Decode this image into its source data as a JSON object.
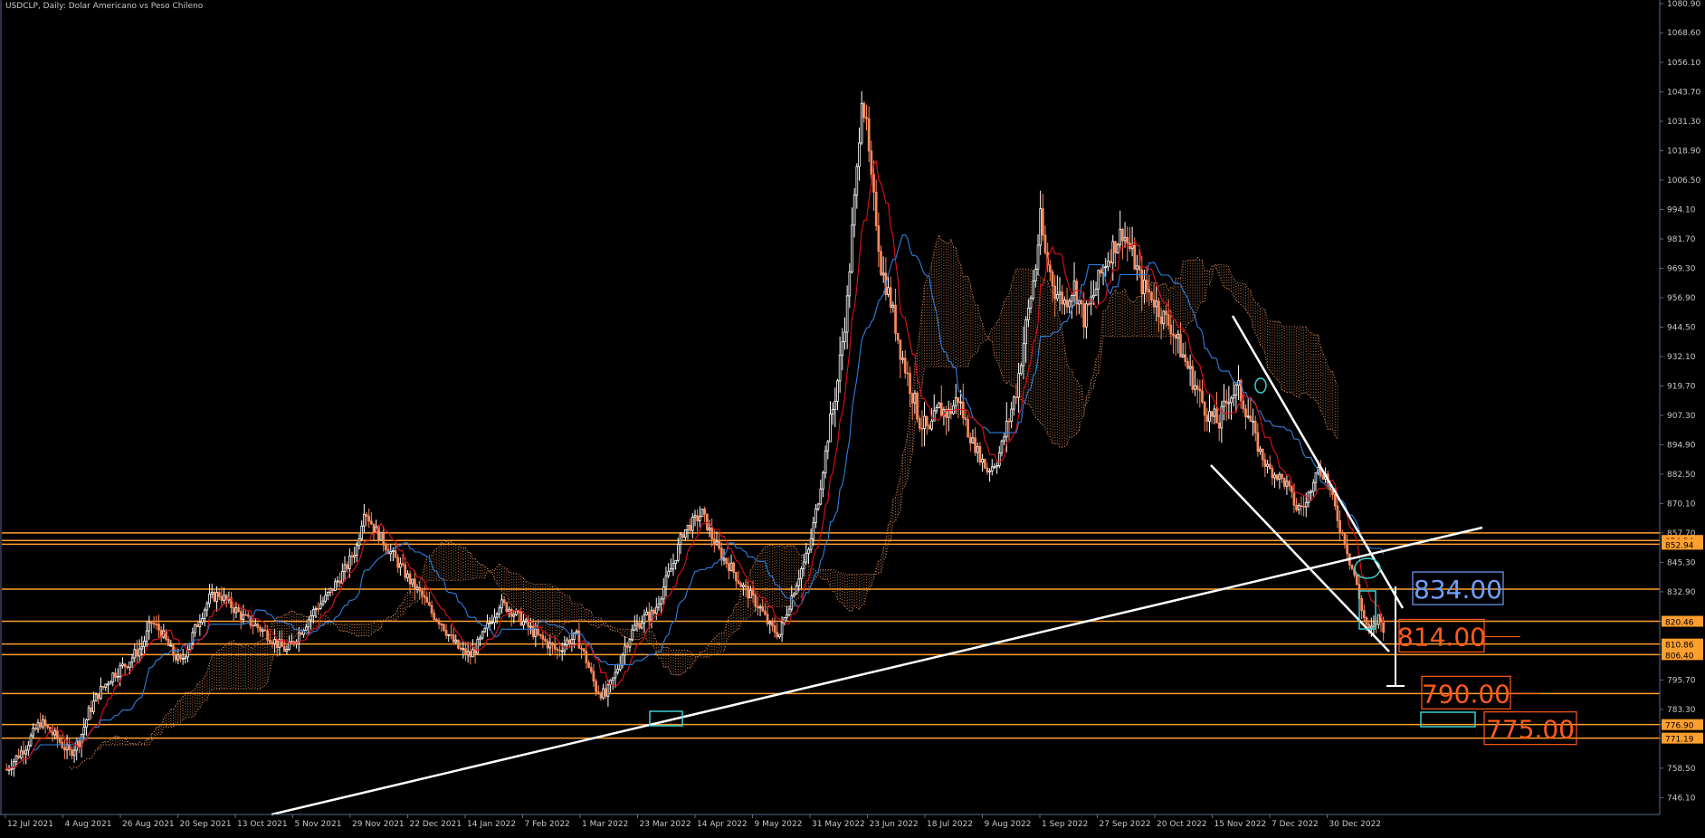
{
  "chart_data": {
    "type": "candlestick",
    "title": "USDCLP, Daily:  Dolar Americano vs Peso Chileno",
    "ylim": [
      739.0,
      1080.9
    ],
    "y_ticks": [
      "1080.90",
      "1068.60",
      "1056.10",
      "1043.70",
      "1031.30",
      "1018.90",
      "1006.50",
      "994.10",
      "981.70",
      "969.30",
      "956.90",
      "944.50",
      "932.10",
      "919.70",
      "907.30",
      "894.90",
      "882.50",
      "870.10",
      "857.70",
      "845.30",
      "832.90",
      "820.46",
      "810.86",
      "806.40",
      "795.70",
      "783.30",
      "776.90",
      "771.19",
      "758.50",
      "746.10"
    ],
    "x_ticks": [
      "12 Jul 2021",
      "4 Aug 2021",
      "26 Aug 2021",
      "20 Sep 2021",
      "13 Oct 2021",
      "5 Nov 2021",
      "29 Nov 2021",
      "22 Dec 2021",
      "14 Jan 2022",
      "7 Feb 2022",
      "1 Mar 2022",
      "23 Mar 2022",
      "14 Apr 2022",
      "9 May 2022",
      "31 May 2022",
      "23 Jun 2022",
      "18 Jul 2022",
      "9 Aug 2022",
      "1 Sep 2022",
      "27 Sep 2022",
      "20 Oct 2022",
      "15 Nov 2022",
      "7 Dec 2022",
      "30 Dec 2022"
    ],
    "price_path": [
      [
        0,
        758
      ],
      [
        8,
        768
      ],
      [
        14,
        778
      ],
      [
        20,
        772
      ],
      [
        26,
        765
      ],
      [
        30,
        770
      ],
      [
        34,
        782
      ],
      [
        38,
        790
      ],
      [
        44,
        798
      ],
      [
        50,
        803
      ],
      [
        56,
        810
      ],
      [
        60,
        820
      ],
      [
        64,
        816
      ],
      [
        68,
        808
      ],
      [
        72,
        803
      ],
      [
        76,
        812
      ],
      [
        80,
        822
      ],
      [
        84,
        830
      ],
      [
        88,
        832
      ],
      [
        92,
        828
      ],
      [
        98,
        822
      ],
      [
        104,
        818
      ],
      [
        108,
        815
      ],
      [
        112,
        811
      ],
      [
        116,
        808
      ],
      [
        120,
        814
      ],
      [
        124,
        820
      ],
      [
        128,
        826
      ],
      [
        132,
        830
      ],
      [
        136,
        836
      ],
      [
        140,
        842
      ],
      [
        145,
        852
      ],
      [
        148,
        868
      ],
      [
        152,
        860
      ],
      [
        156,
        854
      ],
      [
        160,
        848
      ],
      [
        164,
        842
      ],
      [
        168,
        836
      ],
      [
        172,
        831
      ],
      [
        176,
        824
      ],
      [
        180,
        820
      ],
      [
        184,
        813
      ],
      [
        188,
        808
      ],
      [
        192,
        806
      ],
      [
        196,
        812
      ],
      [
        200,
        820
      ],
      [
        204,
        828
      ],
      [
        208,
        826
      ],
      [
        212,
        822
      ],
      [
        216,
        818
      ],
      [
        220,
        814
      ],
      [
        224,
        811
      ],
      [
        228,
        808
      ],
      [
        232,
        812
      ],
      [
        236,
        814
      ],
      [
        240,
        804
      ],
      [
        244,
        792
      ],
      [
        248,
        789
      ],
      [
        252,
        798
      ],
      [
        256,
        810
      ],
      [
        260,
        818
      ],
      [
        264,
        822
      ],
      [
        268,
        824
      ],
      [
        272,
        835
      ],
      [
        276,
        845
      ],
      [
        280,
        858
      ],
      [
        284,
        862
      ],
      [
        288,
        866
      ],
      [
        292,
        856
      ],
      [
        296,
        848
      ],
      [
        300,
        843
      ],
      [
        304,
        836
      ],
      [
        308,
        831
      ],
      [
        312,
        826
      ],
      [
        316,
        818
      ],
      [
        320,
        815
      ],
      [
        324,
        828
      ],
      [
        328,
        840
      ],
      [
        332,
        850
      ],
      [
        336,
        872
      ],
      [
        340,
        898
      ],
      [
        344,
        922
      ],
      [
        348,
        955
      ],
      [
        350,
        985
      ],
      [
        352,
        1010
      ],
      [
        354,
        1043
      ],
      [
        356,
        1028
      ],
      [
        358,
        1005
      ],
      [
        360,
        990
      ],
      [
        362,
        970
      ],
      [
        366,
        955
      ],
      [
        370,
        935
      ],
      [
        374,
        920
      ],
      [
        378,
        905
      ],
      [
        382,
        900
      ],
      [
        386,
        910
      ],
      [
        390,
        908
      ],
      [
        394,
        915
      ],
      [
        398,
        900
      ],
      [
        402,
        892
      ],
      [
        406,
        884
      ],
      [
        410,
        888
      ],
      [
        414,
        902
      ],
      [
        418,
        918
      ],
      [
        422,
        945
      ],
      [
        426,
        970
      ],
      [
        428,
        990
      ],
      [
        430,
        975
      ],
      [
        434,
        960
      ],
      [
        438,
        955
      ],
      [
        442,
        962
      ],
      [
        446,
        948
      ],
      [
        450,
        958
      ],
      [
        454,
        970
      ],
      [
        458,
        978
      ],
      [
        462,
        985
      ],
      [
        466,
        975
      ],
      [
        470,
        962
      ],
      [
        474,
        958
      ],
      [
        478,
        950
      ],
      [
        482,
        945
      ],
      [
        486,
        935
      ],
      [
        490,
        925
      ],
      [
        494,
        915
      ],
      [
        498,
        907
      ],
      [
        502,
        904
      ],
      [
        506,
        916
      ],
      [
        510,
        918
      ],
      [
        514,
        908
      ],
      [
        518,
        894
      ],
      [
        522,
        885
      ],
      [
        526,
        882
      ],
      [
        530,
        878
      ],
      [
        534,
        868
      ],
      [
        538,
        870
      ],
      [
        542,
        885
      ],
      [
        546,
        882
      ],
      [
        548,
        875
      ],
      [
        550,
        868
      ],
      [
        552,
        860
      ],
      [
        554,
        855
      ],
      [
        556,
        846
      ],
      [
        558,
        840
      ],
      [
        560,
        830
      ],
      [
        562,
        822
      ],
      [
        564,
        816
      ],
      [
        566,
        818
      ],
      [
        568,
        822
      ],
      [
        570,
        818
      ]
    ],
    "levels": [
      {
        "price": 857.7,
        "label": "",
        "color": "#ff9f2e"
      },
      {
        "price": 854.54,
        "label": "854.54",
        "color": "#ff9f2e"
      },
      {
        "price": 852.94,
        "label": "852.94",
        "color": "#ff9f2e"
      },
      {
        "price": 834.0,
        "label": "",
        "color": "#ff9f2e"
      },
      {
        "price": 820.46,
        "label": "820.46",
        "color": "#ff9f2e"
      },
      {
        "price": 810.86,
        "label": "810.86",
        "color": "#ff9f2e"
      },
      {
        "price": 806.4,
        "label": "806.40",
        "color": "#ff9f2e"
      },
      {
        "price": 790.0,
        "label": "",
        "color": "#ff9f2e"
      },
      {
        "price": 776.9,
        "label": "776.90",
        "color": "#ff9f2e"
      },
      {
        "price": 771.19,
        "label": "771.19",
        "color": "#ff9f2e"
      }
    ],
    "annotations": [
      {
        "text": "834.00",
        "price": 834.0,
        "color": "#6fa0ff"
      },
      {
        "text": "814.00",
        "price": 814.0,
        "color": "#ff5a1a"
      },
      {
        "text": "790.00",
        "price": 790.0,
        "color": "#ff5a1a"
      },
      {
        "text": "775.00",
        "price": 775.0,
        "color": "#ff5a1a"
      }
    ],
    "colors": {
      "background": "#000000",
      "bull": "#ffffff",
      "bear": "#ff8a5c",
      "tenkan": "#e0101a",
      "kijun": "#2f7fe0",
      "cloud": "#d88a5a",
      "axis": "#5a6a8a",
      "text": "#c8c8c8",
      "levels": "#ff9f2e",
      "trend": "#ffffff",
      "marker": "#3ecfcf"
    }
  }
}
